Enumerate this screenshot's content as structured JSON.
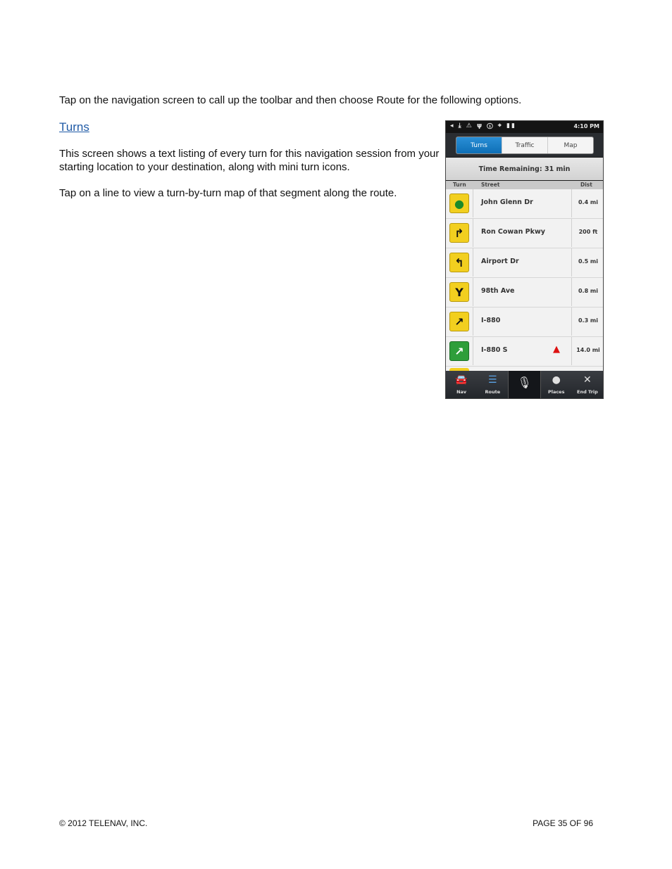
{
  "intro": "Tap on the navigation screen to call up the toolbar and then choose Route for the following options.",
  "section_title": "Turns",
  "description": "This screen shows a text listing of every turn for this navigation session from your starting location to your destination, along with mini turn icons.",
  "tip": "Tap on a line to view a turn-by-turn map of that segment along the route.",
  "phone": {
    "status_time": "4:10 PM",
    "tabs": [
      "Turns",
      "Traffic",
      "Map"
    ],
    "active_tab": "Turns",
    "time_remaining": "Time Remaining: 31 min",
    "columns": {
      "turn": "Turn",
      "street": "Street",
      "dist": "Dist"
    },
    "rows": [
      {
        "icon": "destination-pin-icon",
        "street": "John Glenn Dr",
        "dist": "0.4 mi"
      },
      {
        "icon": "turn-right-icon",
        "street": "Ron Cowan Pkwy",
        "dist": "200 ft"
      },
      {
        "icon": "turn-left-icon",
        "street": "Airport Dr",
        "dist": "0.5 mi"
      },
      {
        "icon": "fork-icon",
        "street": "98th Ave",
        "dist": "0.8 mi"
      },
      {
        "icon": "slight-right-icon",
        "street": "I-880",
        "dist": "0.3 mi"
      },
      {
        "icon": "highway-exit-icon",
        "street": "I-880 S",
        "dist": "14.0 mi"
      }
    ],
    "toolbar": {
      "nav": "Nav",
      "route": "Route",
      "places": "Places",
      "end_trip": "End Trip"
    },
    "colors": {
      "active_tab": "#1a7fc6",
      "turn_icon": "#f2cf1f",
      "exit_icon": "#2e9e3a",
      "position_marker": "#dd1111"
    }
  },
  "footer": {
    "copyright": "© 2012 TELENAV, INC.",
    "page": "PAGE 35 OF 96"
  }
}
